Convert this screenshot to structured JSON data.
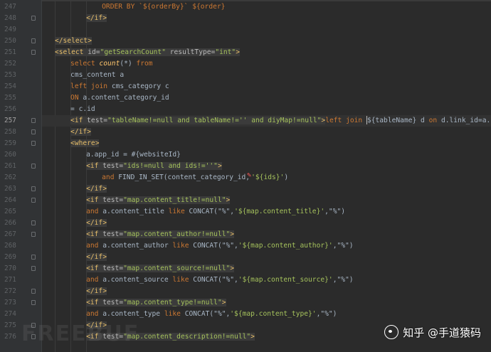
{
  "editor": {
    "lines": [
      {
        "num": "247",
        "indent": 9,
        "tokens": [
          {
            "t": "ORDER BY `${orderBy}` ${order}",
            "c": "kw"
          }
        ]
      },
      {
        "num": "248",
        "indent": 6,
        "tokens": [
          {
            "t": "</if>",
            "c": "tag",
            "hl": true
          }
        ]
      },
      {
        "num": "249",
        "indent": 0,
        "tokens": []
      },
      {
        "num": "250",
        "indent": 0,
        "tokens": [
          {
            "t": "</select>",
            "c": "tag",
            "hl": true
          }
        ]
      },
      {
        "num": "251",
        "indent": 0,
        "tokens": [
          {
            "t": "<select ",
            "c": "tag",
            "hl": true
          },
          {
            "t": "id",
            "c": "attr",
            "hl": true
          },
          {
            "t": "=",
            "c": "attr",
            "hl": true
          },
          {
            "t": "\"getSearchCount\"",
            "c": "val",
            "hl": true
          },
          {
            "t": " resultType",
            "c": "attr",
            "hl": true
          },
          {
            "t": "=",
            "c": "attr",
            "hl": true
          },
          {
            "t": "\"int\"",
            "c": "val",
            "hl": true
          },
          {
            "t": ">",
            "c": "tag",
            "hl": true
          }
        ]
      },
      {
        "num": "252",
        "indent": 3,
        "tokens": [
          {
            "t": "select ",
            "c": "kw"
          },
          {
            "t": "count",
            "c": "fn"
          },
          {
            "t": "(*) ",
            "c": "txt"
          },
          {
            "t": "from",
            "c": "kw"
          }
        ]
      },
      {
        "num": "253",
        "indent": 3,
        "tokens": [
          {
            "t": "cms_content a",
            "c": "txt"
          }
        ]
      },
      {
        "num": "254",
        "indent": 3,
        "tokens": [
          {
            "t": "left join ",
            "c": "kw"
          },
          {
            "t": "cms_category c",
            "c": "txt"
          }
        ]
      },
      {
        "num": "255",
        "indent": 3,
        "tokens": [
          {
            "t": "ON ",
            "c": "kw"
          },
          {
            "t": "a.content_category_id",
            "c": "txt"
          }
        ]
      },
      {
        "num": "256",
        "indent": 3,
        "tokens": [
          {
            "t": "= c.id",
            "c": "txt"
          }
        ]
      },
      {
        "num": "257",
        "indent": 3,
        "current": true,
        "tokens": [
          {
            "t": "<if ",
            "c": "tag",
            "hl": true
          },
          {
            "t": "test",
            "c": "attr",
            "hl": true
          },
          {
            "t": "=",
            "c": "attr",
            "hl": true
          },
          {
            "t": "\"tableName!=null and tableName!='' and diyMap!=null\"",
            "c": "val",
            "hl": true
          },
          {
            "t": ">",
            "c": "tag",
            "hl": true
          },
          {
            "t": "left join ",
            "c": "kw"
          },
          {
            "t": "$",
            "c": "txt",
            "caret": true
          },
          {
            "t": "{tableName} d ",
            "c": "txt"
          },
          {
            "t": "on ",
            "c": "kw"
          },
          {
            "t": "d.link_id=a.id",
            "c": "txt"
          }
        ]
      },
      {
        "num": "258",
        "indent": 3,
        "tokens": [
          {
            "t": "</if>",
            "c": "tag",
            "hl": true
          }
        ]
      },
      {
        "num": "259",
        "indent": 3,
        "tokens": [
          {
            "t": "<where>",
            "c": "tag",
            "hl": true
          }
        ]
      },
      {
        "num": "260",
        "indent": 6,
        "tokens": [
          {
            "t": "a.app_id = #{websiteId}",
            "c": "txt"
          }
        ]
      },
      {
        "num": "261",
        "indent": 6,
        "tokens": [
          {
            "t": "<if ",
            "c": "tag",
            "hl": true
          },
          {
            "t": "test",
            "c": "attr",
            "hl": true
          },
          {
            "t": "=",
            "c": "attr",
            "hl": true
          },
          {
            "t": "\"ids!=null and ids!=''\"",
            "c": "val",
            "hl": true
          },
          {
            "t": ">",
            "c": "tag",
            "hl": true
          }
        ]
      },
      {
        "num": "262",
        "indent": 9,
        "tokens": [
          {
            "t": "and ",
            "c": "kw"
          },
          {
            "t": "FIND_IN_SET(content_category_id,",
            "c": "txt"
          },
          {
            "t": "'${ids}'",
            "c": "val",
            "err": true
          },
          {
            "t": ")",
            "c": "txt"
          }
        ]
      },
      {
        "num": "263",
        "indent": 6,
        "tokens": [
          {
            "t": "</if>",
            "c": "tag",
            "hl": true
          }
        ]
      },
      {
        "num": "264",
        "indent": 6,
        "tokens": [
          {
            "t": "<if ",
            "c": "tag",
            "hl": true
          },
          {
            "t": "test",
            "c": "attr",
            "hl": true
          },
          {
            "t": "=",
            "c": "attr",
            "hl": true
          },
          {
            "t": "\"map.content_title!=null\"",
            "c": "val",
            "hl": true
          },
          {
            "t": ">",
            "c": "tag",
            "hl": true
          }
        ]
      },
      {
        "num": "265",
        "indent": 6,
        "tokens": [
          {
            "t": "and ",
            "c": "kw"
          },
          {
            "t": "a.content_title ",
            "c": "txt"
          },
          {
            "t": "like ",
            "c": "kw"
          },
          {
            "t": "CONCAT(\"%\",",
            "c": "txt"
          },
          {
            "t": "'${map.content_title}'",
            "c": "val"
          },
          {
            "t": ",\"%\")",
            "c": "txt"
          }
        ]
      },
      {
        "num": "266",
        "indent": 6,
        "tokens": [
          {
            "t": "</if>",
            "c": "tag",
            "hl": true
          }
        ]
      },
      {
        "num": "267",
        "indent": 6,
        "tokens": [
          {
            "t": "<if ",
            "c": "tag",
            "hl": true
          },
          {
            "t": "test",
            "c": "attr",
            "hl": true
          },
          {
            "t": "=",
            "c": "attr",
            "hl": true
          },
          {
            "t": "\"map.content_author!=null\"",
            "c": "val",
            "hl": true
          },
          {
            "t": ">",
            "c": "tag",
            "hl": true
          }
        ]
      },
      {
        "num": "268",
        "indent": 6,
        "tokens": [
          {
            "t": "and ",
            "c": "kw"
          },
          {
            "t": "a.content_author ",
            "c": "txt"
          },
          {
            "t": "like ",
            "c": "kw"
          },
          {
            "t": "CONCAT(\"%\",",
            "c": "txt"
          },
          {
            "t": "'${map.content_author}'",
            "c": "val"
          },
          {
            "t": ",\"%\")",
            "c": "txt"
          }
        ]
      },
      {
        "num": "269",
        "indent": 6,
        "tokens": [
          {
            "t": "</if>",
            "c": "tag",
            "hl": true
          }
        ]
      },
      {
        "num": "270",
        "indent": 6,
        "tokens": [
          {
            "t": "<if ",
            "c": "tag",
            "hl": true
          },
          {
            "t": "test",
            "c": "attr",
            "hl": true
          },
          {
            "t": "=",
            "c": "attr",
            "hl": true
          },
          {
            "t": "\"map.content_source!=null\"",
            "c": "val",
            "hl": true
          },
          {
            "t": ">",
            "c": "tag",
            "hl": true
          }
        ]
      },
      {
        "num": "271",
        "indent": 6,
        "tokens": [
          {
            "t": "and ",
            "c": "kw"
          },
          {
            "t": "a.content_source ",
            "c": "txt"
          },
          {
            "t": "like ",
            "c": "kw"
          },
          {
            "t": "CONCAT(\"%\",",
            "c": "txt"
          },
          {
            "t": "'${map.content_source}'",
            "c": "val"
          },
          {
            "t": ",\"%\")",
            "c": "txt"
          }
        ]
      },
      {
        "num": "272",
        "indent": 6,
        "tokens": [
          {
            "t": "</if>",
            "c": "tag",
            "hl": true
          }
        ]
      },
      {
        "num": "273",
        "indent": 6,
        "tokens": [
          {
            "t": "<if ",
            "c": "tag",
            "hl": true
          },
          {
            "t": "test",
            "c": "attr",
            "hl": true
          },
          {
            "t": "=",
            "c": "attr",
            "hl": true
          },
          {
            "t": "\"map.content_type!=null\"",
            "c": "val",
            "hl": true
          },
          {
            "t": ">",
            "c": "tag",
            "hl": true
          }
        ]
      },
      {
        "num": "274",
        "indent": 6,
        "tokens": [
          {
            "t": "and ",
            "c": "kw"
          },
          {
            "t": "a.content_type ",
            "c": "txt"
          },
          {
            "t": "like ",
            "c": "kw"
          },
          {
            "t": "CONCAT(\"%\",",
            "c": "txt"
          },
          {
            "t": "'${map.content_type}'",
            "c": "val"
          },
          {
            "t": ",\"%\")",
            "c": "txt"
          }
        ]
      },
      {
        "num": "275",
        "indent": 6,
        "tokens": [
          {
            "t": "</if>",
            "c": "tag",
            "hl": true
          }
        ]
      },
      {
        "num": "276",
        "indent": 6,
        "tokens": [
          {
            "t": "<if ",
            "c": "tag",
            "hl": true
          },
          {
            "t": "test",
            "c": "attr",
            "hl": true
          },
          {
            "t": "=",
            "c": "attr",
            "hl": true
          },
          {
            "t": "\"map.content_description!=null\"",
            "c": "val",
            "hl": true
          },
          {
            "t": ">",
            "c": "tag",
            "hl": true
          }
        ]
      }
    ],
    "fold_markers": [
      "248",
      "250",
      "251",
      "257",
      "258",
      "259",
      "261",
      "263",
      "264",
      "266",
      "267",
      "269",
      "270",
      "272",
      "273",
      "275",
      "276"
    ]
  },
  "watermarks": {
    "left_text": "FREEBUF",
    "right_text": "知乎 @手道猿码"
  },
  "colors": {
    "background": "#2b2b2b",
    "gutter": "#313335",
    "tag": "#e8bf6a",
    "keyword": "#cc7832",
    "string": "#a5c25c",
    "text": "#a9b7c6"
  }
}
